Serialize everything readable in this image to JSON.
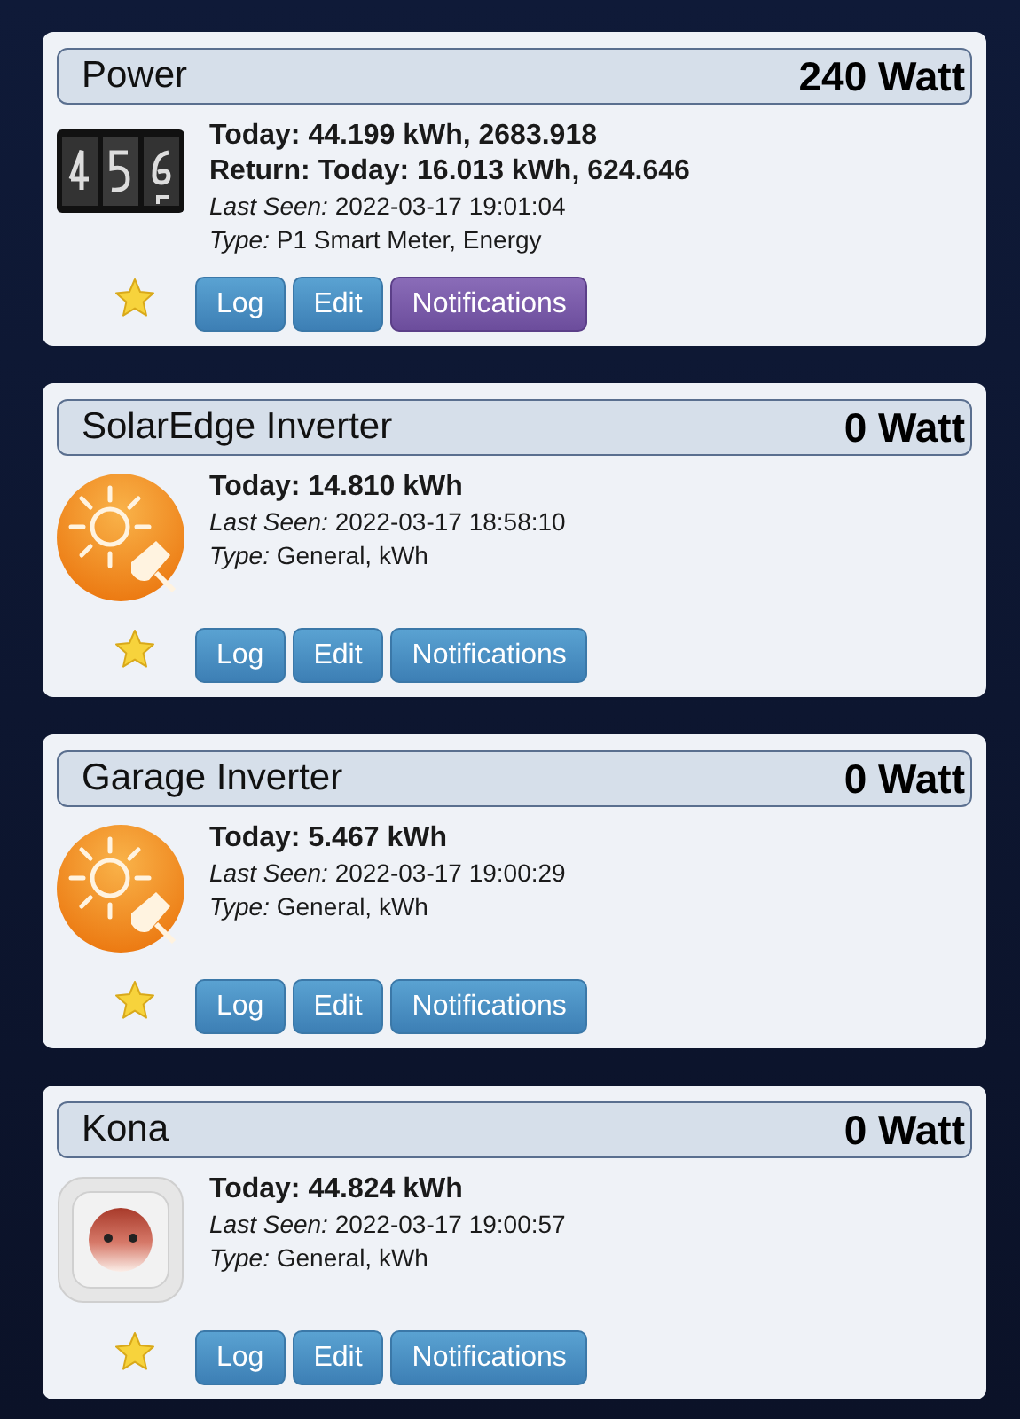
{
  "devices": [
    {
      "name": "Power",
      "reading": "240 Watt",
      "kind": "meter",
      "lines": [
        {
          "kind": "bold",
          "text": "Today: 44.199 kWh, 2683.918"
        },
        {
          "kind": "bold",
          "text": "Return: Today: 16.013 kWh, 624.646"
        },
        {
          "kind": "labeled",
          "label": "Last Seen:",
          "text": "2022-03-17 19:01:04"
        },
        {
          "kind": "labeled",
          "label": "Type:",
          "text": "P1 Smart Meter, Energy"
        }
      ],
      "buttons": {
        "log": "Log",
        "edit": "Edit",
        "notifications": "Notifications"
      },
      "notifications_active": true
    },
    {
      "name": "SolarEdge Inverter",
      "reading": "0 Watt",
      "kind": "solar",
      "lines": [
        {
          "kind": "bold",
          "text": "Today: 14.810 kWh"
        },
        {
          "kind": "labeled",
          "label": "Last Seen:",
          "text": "2022-03-17 18:58:10"
        },
        {
          "kind": "labeled",
          "label": "Type:",
          "text": "General, kWh"
        }
      ],
      "buttons": {
        "log": "Log",
        "edit": "Edit",
        "notifications": "Notifications"
      },
      "notifications_active": false
    },
    {
      "name": "Garage Inverter",
      "reading": "0 Watt",
      "kind": "solar",
      "lines": [
        {
          "kind": "bold",
          "text": "Today: 5.467 kWh"
        },
        {
          "kind": "labeled",
          "label": "Last Seen:",
          "text": "2022-03-17 19:00:29"
        },
        {
          "kind": "labeled",
          "label": "Type:",
          "text": "General, kWh"
        }
      ],
      "buttons": {
        "log": "Log",
        "edit": "Edit",
        "notifications": "Notifications"
      },
      "notifications_active": false
    },
    {
      "name": "Kona",
      "reading": "0 Watt",
      "kind": "socket",
      "lines": [
        {
          "kind": "bold",
          "text": "Today: 44.824 kWh"
        },
        {
          "kind": "labeled",
          "label": "Last Seen:",
          "text": "2022-03-17 19:00:57"
        },
        {
          "kind": "labeled",
          "label": "Type:",
          "text": "General, kWh"
        }
      ],
      "buttons": {
        "log": "Log",
        "edit": "Edit",
        "notifications": "Notifications"
      },
      "notifications_active": false
    }
  ]
}
